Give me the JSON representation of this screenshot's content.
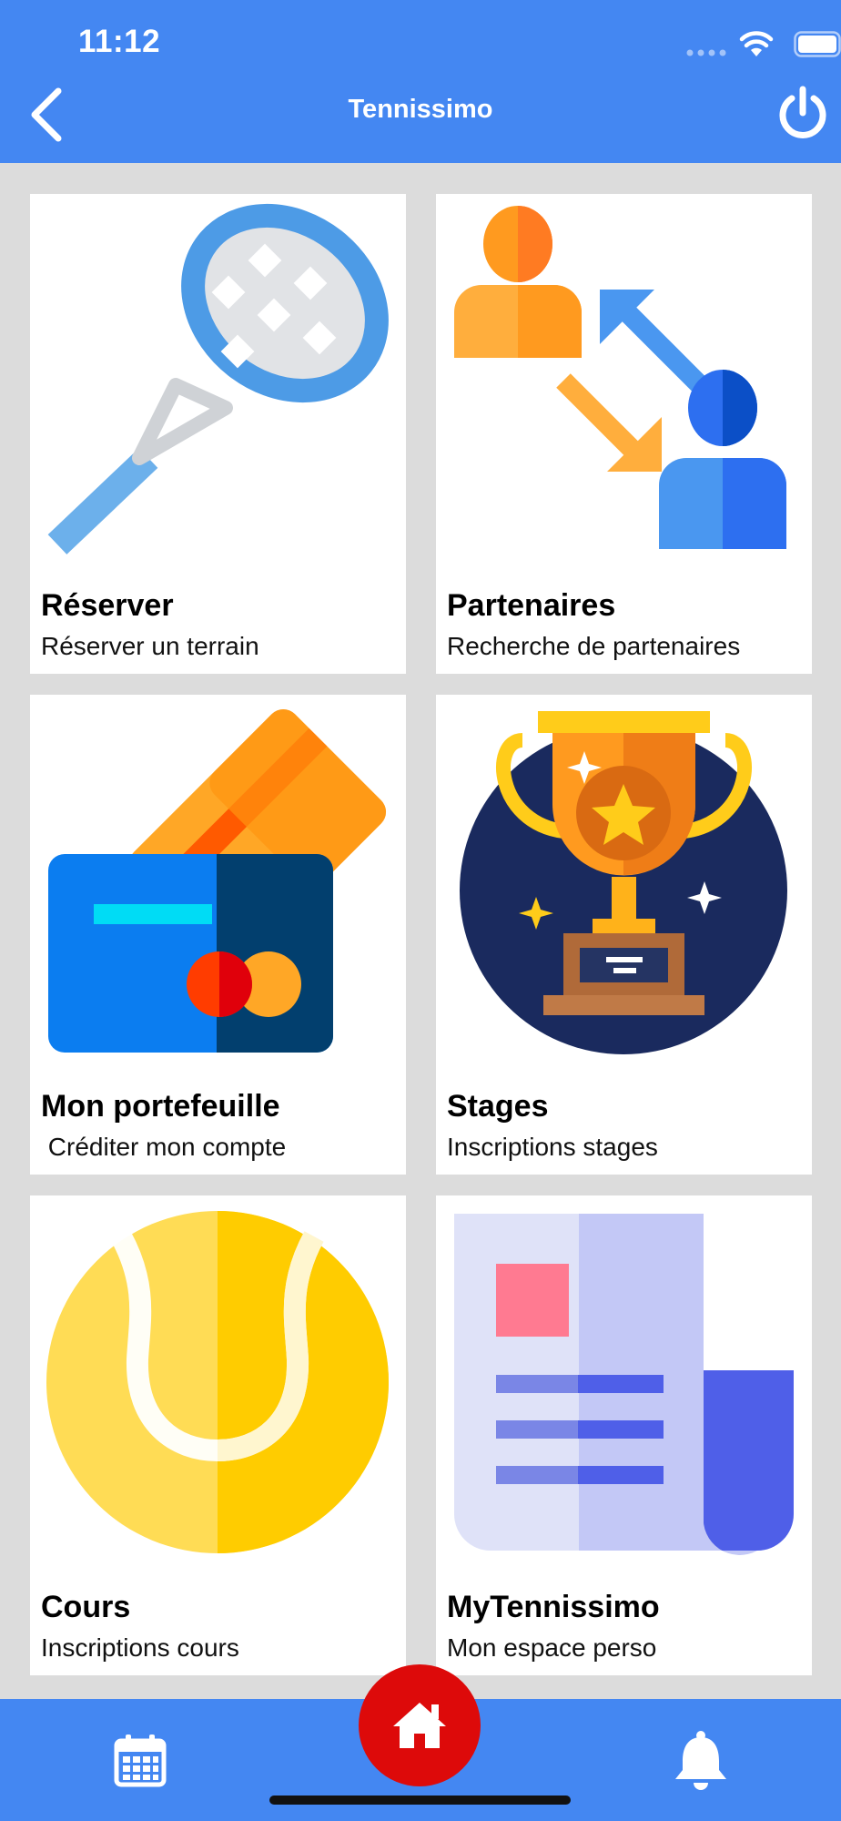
{
  "status_bar": {
    "time": "11:12"
  },
  "header": {
    "title": "Tennissimo"
  },
  "tiles": [
    {
      "title": "Réserver",
      "subtitle": "Réserver un terrain",
      "icon": "tennis-racket-icon"
    },
    {
      "title": "Partenaires",
      "subtitle": "Recherche de partenaires",
      "icon": "partners-exchange-icon"
    },
    {
      "title": "Mon portefeuille",
      "subtitle": " Créditer mon compte",
      "icon": "credit-cards-icon"
    },
    {
      "title": "Stages",
      "subtitle": "Inscriptions stages",
      "icon": "trophy-icon"
    },
    {
      "title": "Cours",
      "subtitle": "Inscriptions cours",
      "icon": "tennis-ball-icon"
    },
    {
      "title": "MyTennissimo",
      "subtitle": "Mon espace perso",
      "icon": "newspaper-icon"
    }
  ],
  "bottom_nav": {
    "items": [
      "calendar-icon",
      "home-icon",
      "bell-icon"
    ],
    "active": "home-icon"
  },
  "colors": {
    "header": "#4487f2",
    "home_button": "#dd0a0a",
    "background": "#dcdcdc"
  }
}
